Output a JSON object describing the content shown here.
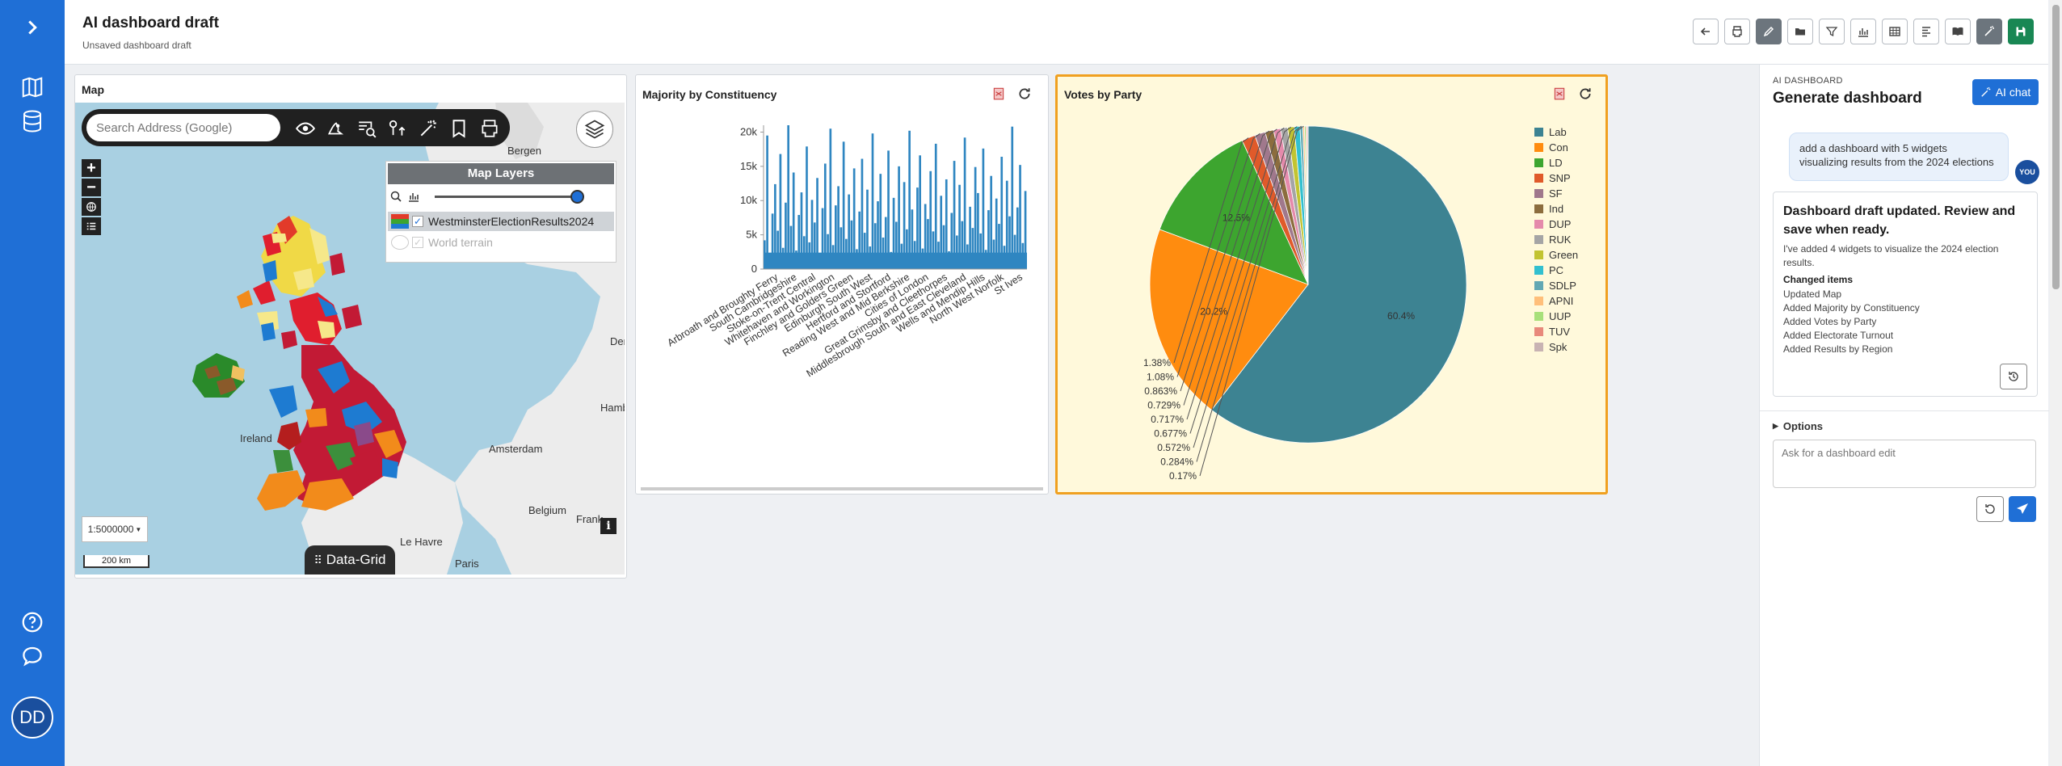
{
  "header": {
    "title": "AI dashboard draft",
    "subtitle": "Unsaved dashboard draft",
    "toolbar": [
      "back-icon",
      "print-icon",
      "edit-icon",
      "folder-icon",
      "filter-icon",
      "bar-chart-icon",
      "table-icon",
      "align-icon",
      "book-icon",
      "magic-wand-icon",
      "save-icon"
    ]
  },
  "rail": {
    "items": [
      "expand-icon",
      "map-icon",
      "database-icon",
      "help-icon",
      "chat-icon"
    ],
    "avatar": "DD"
  },
  "map_widget": {
    "title": "Map",
    "search_placeholder": "Search Address (Google)",
    "layer_panel_title": "Map Layers",
    "layers": [
      {
        "name": "WestminsterElectionResults2024",
        "checked": true
      },
      {
        "name": "World terrain",
        "checked": true
      }
    ],
    "scale": "1:5000000",
    "scale_bar": "200 km",
    "data_grid_label": "Data-Grid",
    "place_labels": [
      "Bergen",
      "Ireland",
      "Amsterdam",
      "Belgium",
      "Paris",
      "Le Havre",
      "Den",
      "Hamb",
      "Frank"
    ]
  },
  "bar_widget": {
    "title": "Majority by Constituency",
    "chart_data": {
      "type": "bar",
      "title": "",
      "xlabel": "",
      "ylabel": "",
      "ylim": [
        0,
        21000
      ],
      "y_ticks": [
        "0",
        "5k",
        "10k",
        "15k",
        "20k"
      ],
      "x_tick_labels": [
        "Arbroath and Broughty Ferry",
        "South Cambridgeshire",
        "Stoke-on-Trent Central",
        "Whitehaven and Workington",
        "Finchley and Golders Green",
        "Edinburgh South West",
        "Hertford and Stortford",
        "Reading West and Mid Berkshire",
        "Cities of London",
        "Great Grimsby and Cleethorpes",
        "Middlesbrough South and East Cleveland",
        "Wells and Mendip Hills",
        "North West Norfolk",
        "St Ives"
      ],
      "values": [
        4200,
        19500,
        2300,
        8100,
        12400,
        5600,
        16800,
        3100,
        9700,
        21000,
        6300,
        14100,
        2700,
        7900,
        11200,
        4800,
        17900,
        3900,
        10100,
        6800,
        13300,
        2100,
        8900,
        15400,
        5100,
        20500,
        3500,
        9300,
        12100,
        6100,
        18600,
        4400,
        10900,
        7100,
        14700,
        2900,
        8400,
        16100,
        5300,
        11600,
        3300,
        19800,
        6700,
        9900,
        13900,
        4600,
        7600,
        17300,
        2500,
        10400,
        6900,
        15000,
        3700,
        12700,
        5800,
        20200,
        8700,
        4100,
        11900,
        16600,
        3000,
        9500,
        7300,
        14300,
        5500,
        18300,
        4000,
        10700,
        6400,
        13100,
        2600,
        8200,
        15800,
        4900,
        12300,
        7000,
        19200,
        3600,
        9100,
        6000,
        14900,
        11100,
        5200,
        17600,
        2800,
        8600,
        13600,
        4300,
        10300,
        6600,
        16400,
        3400,
        12900,
        7700,
        20800,
        5000,
        9000,
        15200,
        3800,
        11400
      ]
    }
  },
  "pie_widget": {
    "title": "Votes by Party",
    "chart_data": {
      "type": "pie",
      "title": "",
      "labels": [
        "Lab",
        "Con",
        "LD",
        "SNP",
        "SF",
        "Ind",
        "DUP",
        "RUK",
        "Green",
        "PC",
        "SDLP",
        "APNI",
        "UUP",
        "TUV",
        "Spk"
      ],
      "values": [
        60.4,
        20.2,
        12.5,
        1.38,
        1.08,
        0.863,
        0.729,
        0.717,
        0.677,
        0.572,
        0.284,
        0.17,
        0.15,
        0.12,
        0.1
      ],
      "value_labels": [
        "60.4%",
        "20.2%",
        "12.5%",
        "1.38%",
        "1.08%",
        "0.863%",
        "0.729%",
        "0.717%",
        "0.677%",
        "0.572%",
        "0.284%",
        "0.17%"
      ],
      "colors": [
        "#3d8392",
        "#ff8c0f",
        "#3da52f",
        "#e05a2a",
        "#a0788c",
        "#8c6d3e",
        "#e58aab",
        "#a5a5a5",
        "#c2c431",
        "#32c0cf",
        "#62a8b3",
        "#ffbf7a",
        "#a8e07a",
        "#e8897b",
        "#c8b3b3"
      ],
      "legend": "right"
    }
  },
  "ai_panel": {
    "eyebrow": "AI DASHBOARD",
    "heading": "Generate dashboard",
    "ai_chat_button": "AI chat",
    "user_message": "add a dashboard with 5 widgets visualizing results from the 2024 elections",
    "user_badge": "YOU",
    "response_title": "Dashboard draft updated. Review and save when ready.",
    "response_text": "I've added 4 widgets to visualize the 2024 election results.",
    "changed_items_label": "Changed items",
    "changed_items": [
      "Updated Map",
      "Added Majority by Constituency",
      "Added Votes by Party",
      "Added Electorate Turnout",
      "Added Results by Region"
    ],
    "options_label": "Options",
    "input_placeholder": "Ask for a dashboard edit"
  }
}
